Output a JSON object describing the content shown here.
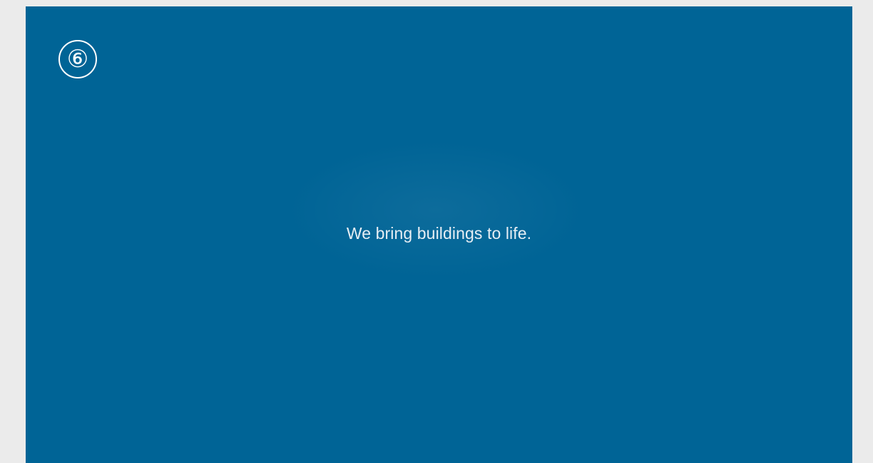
{
  "screen": {
    "step_number": "⑥",
    "tagline": "We bring buildings to life."
  },
  "colors": {
    "page_background": "#ebebeb",
    "screen_background": "#006496",
    "text": "#ffffff"
  }
}
